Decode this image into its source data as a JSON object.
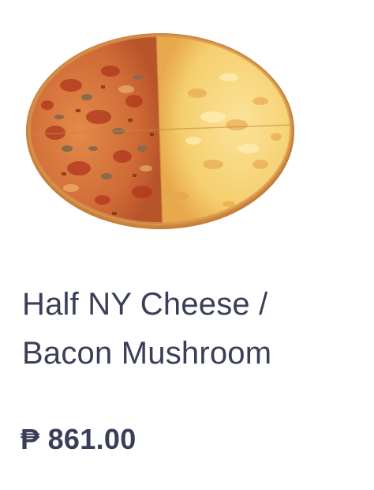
{
  "product": {
    "image_alt": "Half NY Cheese / Bacon Mushroom pizza",
    "name_line1": "Half NY Cheese /",
    "name_line2": "Bacon Mushroom",
    "price": "₱ 861.00"
  },
  "colors": {
    "text": "#3a3e58",
    "background": "#ffffff"
  }
}
